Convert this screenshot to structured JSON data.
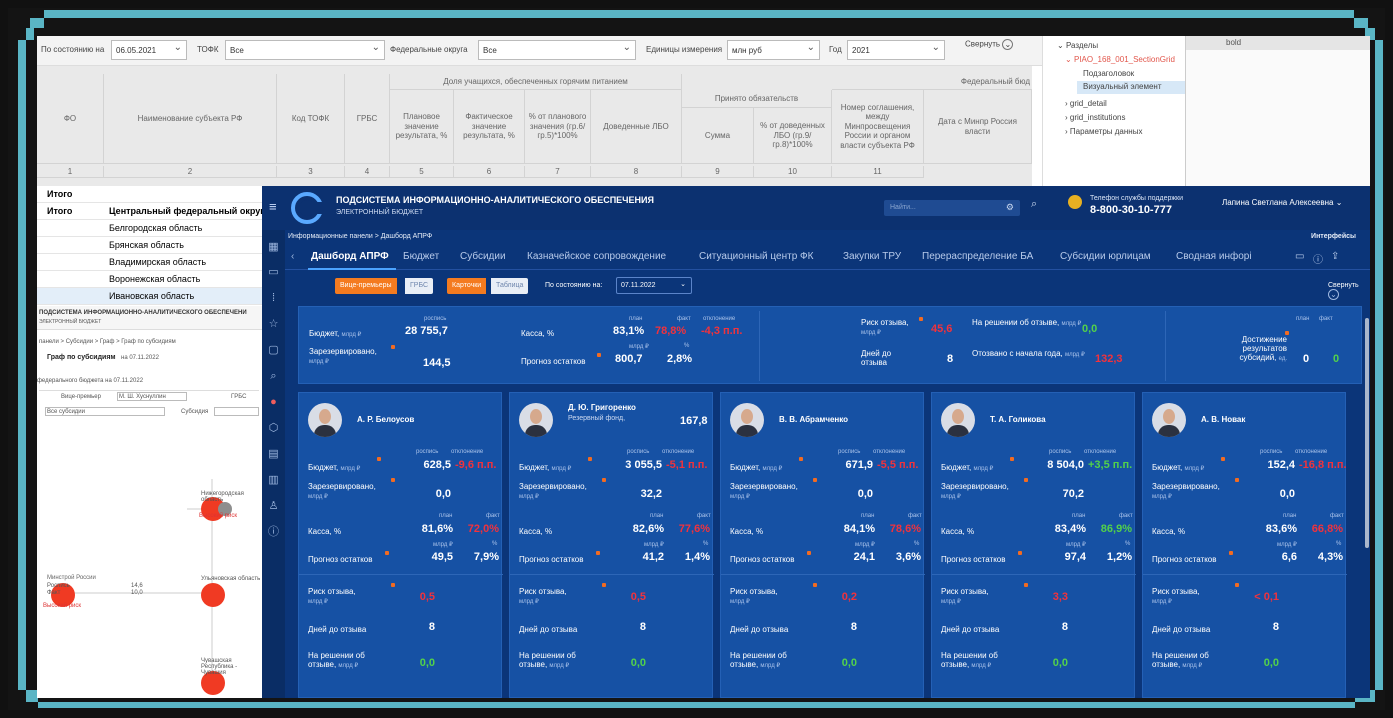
{
  "sheet": {
    "filters": {
      "date_label": "По состоянию на",
      "date_value": "06.05.2021",
      "tofk_label": "ТОФК",
      "tofk_value": "Все",
      "okrug_label": "Федеральные округа",
      "okrug_value": "Все",
      "units_label": "Единицы измерения",
      "units_value": "млн руб",
      "year_label": "Год",
      "year_value": "2021",
      "collapse_label": "Свернуть"
    },
    "headers": {
      "fo": "ФО",
      "subject": "Наименование субъекта РФ",
      "tofk_code": "Код ТОФК",
      "grbs": "ГРБС",
      "share_group": "Доля учащихся, обеспеченных горячим питанием",
      "plan": "Плановое значение результата, %",
      "fact": "Фактическое значение результата, %",
      "pct": "% от планового значения (гр.6/ гр.5)*100%",
      "lbo": "Доведенные ЛБО",
      "accepted": "Принято обязательств",
      "sum": "Сумма",
      "pct_lbo": "% от доведенных ЛБО (гр.9/гр.8)*100%",
      "agreement": "Номер соглашения, между Минпросвещения России и органом власти субъекта РФ",
      "date_cut": "Дата с Минпр Россия власти",
      "fed_budget": "Федеральный бюд",
      "nums": [
        "1",
        "2",
        "3",
        "4",
        "5",
        "6",
        "7",
        "8",
        "9",
        "10",
        "11"
      ]
    },
    "tree": {
      "root": "Разделы",
      "selected": "PIAO_168_001_SectionGrid",
      "child1": "Подзаголовок",
      "child2": "Визуальный элемент",
      "node2": "grid_detail",
      "node3": "grid_institutions",
      "node4": "Параметры данных"
    },
    "prop_header": "bold",
    "rows": [
      {
        "a": "Итого",
        "b": ""
      },
      {
        "a": "Итого",
        "b": "Центральный федеральный округ"
      },
      {
        "a": "",
        "b": "Белгородская область"
      },
      {
        "a": "",
        "b": "Брянская область"
      },
      {
        "a": "",
        "b": "Владимирская область"
      },
      {
        "a": "",
        "b": "Воронежская область"
      },
      {
        "a": "",
        "b": "Ивановская область"
      }
    ]
  },
  "mini": {
    "header": "ПОДСИСТЕМА ИНФОРМАЦИОННО-АНАЛИТИЧЕСКОГО ОБЕСПЕЧЕНИ",
    "sub": "ЭЛЕКТРОННЫЙ БЮДЖЕТ",
    "crumb": "панели > Субсидии > Граф > Граф по субсидиям",
    "title": "Граф по субсидиям",
    "date": "на 07.11.2022",
    "budget_line": "федерального бюджета на 07.11.2022",
    "vid_label": "Вице-премьер",
    "vid_value": "М. Ш. Хуснуллин",
    "grbs_label": "ГРБС",
    "subs_label": "Субсидия",
    "all_subs": "Все субсидии",
    "node_label": "Минстрой России",
    "node_r": "Роспись",
    "node_f": "Факт",
    "node_v1": "14,6",
    "node_v2": "10,0",
    "risk": "Высокий риск",
    "right1": "Нижегородская область",
    "right2": "Ульяновская область",
    "right3": "Чувашская Республика - Чувашия"
  },
  "dash": {
    "system_title": "ПОДСИСТЕМА ИНФОРМАЦИОННО-АНАЛИТИЧЕСКОГО ОБЕСПЕЧЕНИЯ",
    "system_sub": "ЭЛЕКТРОННЫЙ БЮДЖЕТ",
    "search_placeholder": "Найти...",
    "support_label": "Телефон службы поддержки",
    "support_phone": "8-800-30-10-777",
    "user": "Лапина Светлана Алексеевна",
    "breadcrumb": "Информационные панели > Дашборд АПРФ",
    "interfaces": "Интерфейсы",
    "tabs": [
      "Дашборд АПРФ",
      "Бюджет",
      "Субсидии",
      "Казначейское сопровождение",
      "Ситуационный центр ФК",
      "Закупки ТРУ",
      "Перераспределение БА",
      "Субсидии юрлицам",
      "Сводная инфорі"
    ],
    "toggle1_a": "Вице-премьеры",
    "toggle1_b": "ГРБС",
    "toggle2_a": "Карточки",
    "toggle2_b": "Таблица",
    "date_label": "По состоянию на:",
    "date_value": "07.11.2022",
    "collapse": "Свернуть",
    "summary": {
      "budget_label": "Бюджет,",
      "budget_unit": "млрд ₽",
      "budget_hdr": "роспись",
      "budget_val": "28 755,7",
      "reserved_label": "Зарезервировано,",
      "reserved_unit": "млрд ₽",
      "reserved_val": "144,5",
      "kassa_label": "Касса, %",
      "plan_hdr": "план",
      "fact_hdr": "факт",
      "dev_hdr": "отклонение",
      "kassa_plan": "83,1%",
      "kassa_fact": "78,8%",
      "kassa_dev": "-4,3 п.п.",
      "forecast_label": "Прогноз остатков",
      "forecast_hdr1": "млрд ₽",
      "forecast_hdr2": "%",
      "forecast_val": "800,7",
      "forecast_pct": "2,8%",
      "risk_label": "Риск отзыва,",
      "risk_unit": "млрд ₽",
      "risk_val": "45,6",
      "days_label": "Дней до отзыва",
      "days_val": "8",
      "decision_label": "На решении об отзыве,",
      "decision_unit": "млрд ₽",
      "decision_val": "0,0",
      "recalled_label": "Отозвано с начала года,",
      "recalled_unit": "млрд ₽",
      "recalled_val": "132,3",
      "ach_hdr_plan": "план",
      "ach_hdr_fact": "факт",
      "ach_label": "Достижение результатов субсидий,",
      "ach_unit": "ед.",
      "ach_plan": "0",
      "ach_fact": "0"
    },
    "labels": {
      "budget": "Бюджет,",
      "unit": "млрд ₽",
      "rospis": "роспись",
      "otkl": "отклонение",
      "reserved": "Зарезервировано,",
      "plan": "план",
      "fact": "факт",
      "kassa": "Касса, %",
      "mlrd": "млрд ₽",
      "pct": "%",
      "forecast": "Прогноз остатков",
      "risk": "Риск отзыва,",
      "days": "Дней до отзыва",
      "decision": "На решении об",
      "decision2": "отзыве,"
    },
    "cards": [
      {
        "name": "А. Р. Белоусов",
        "sub": "",
        "sub_val": "",
        "budget": "628,5",
        "dev": "-9,6 п.п.",
        "dev_color": "#f2323c",
        "reserved": "0,0",
        "plan": "81,6%",
        "fact": "72,0%",
        "fact_color": "#f2323c",
        "forecast": "49,5",
        "forecast_pct": "7,9%",
        "risk": "0,5",
        "days": "8",
        "decision": "0,0"
      },
      {
        "name": "Д. Ю. Григоренко",
        "sub": "Резервный фонд,",
        "sub_val": "167,8",
        "budget": "3 055,5",
        "dev": "-5,1 п.п.",
        "dev_color": "#f2323c",
        "reserved": "32,2",
        "plan": "82,6%",
        "fact": "77,6%",
        "fact_color": "#f2323c",
        "forecast": "41,2",
        "forecast_pct": "1,4%",
        "risk": "0,5",
        "days": "8",
        "decision": "0,0"
      },
      {
        "name": "В. В. Абрамченко",
        "sub": "",
        "sub_val": "",
        "budget": "671,9",
        "dev": "-5,5 п.п.",
        "dev_color": "#f2323c",
        "reserved": "0,0",
        "plan": "84,1%",
        "fact": "78,6%",
        "fact_color": "#f2323c",
        "forecast": "24,1",
        "forecast_pct": "3,6%",
        "risk": "0,2",
        "days": "8",
        "decision": "0,0"
      },
      {
        "name": "Т. А. Голикова",
        "sub": "",
        "sub_val": "",
        "budget": "8 504,0",
        "dev": "+3,5 п.п.",
        "dev_color": "#53d24a",
        "reserved": "70,2",
        "plan": "83,4%",
        "fact": "86,9%",
        "fact_color": "#53d24a",
        "forecast": "97,4",
        "forecast_pct": "1,2%",
        "risk": "3,3",
        "days": "8",
        "decision": "0,0"
      },
      {
        "name": "А. В. Новак",
        "sub": "",
        "sub_val": "",
        "budget": "152,4",
        "dev": "-16,8 п.п.",
        "dev_color": "#f2323c",
        "reserved": "0,0",
        "plan": "83,6%",
        "fact": "66,8%",
        "fact_color": "#f2323c",
        "forecast": "6,6",
        "forecast_pct": "4,3%",
        "risk": "< 0,1",
        "days": "8",
        "decision": "0,0"
      }
    ]
  }
}
